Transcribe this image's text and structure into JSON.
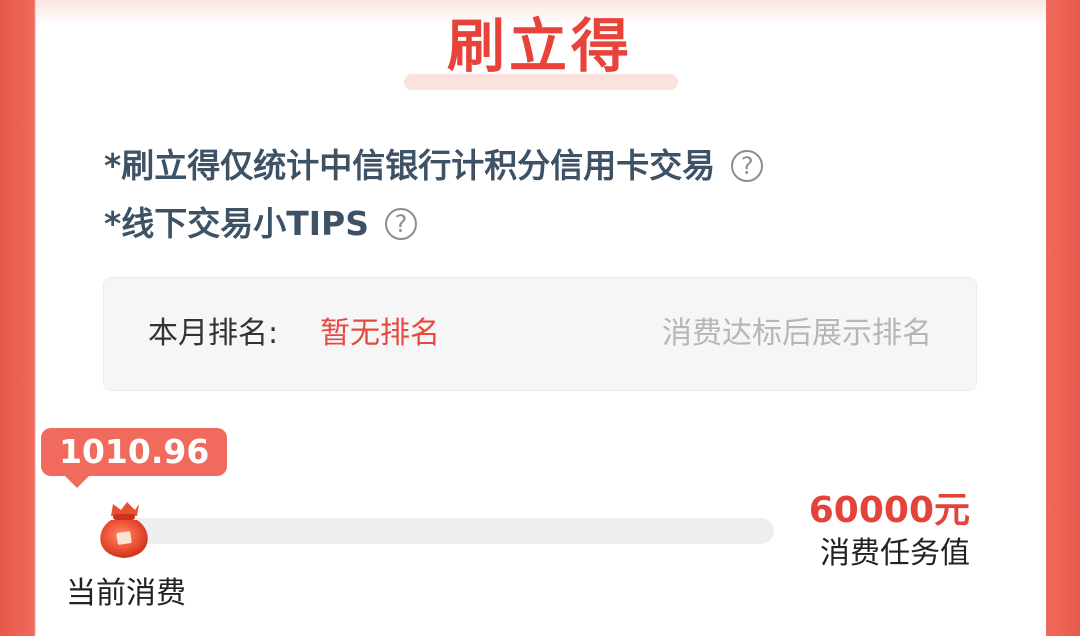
{
  "header": {
    "title": "刷立得"
  },
  "tips": [
    {
      "text": "*刷立得仅统计中信银行计积分信用卡交易",
      "icon": "question-circle-icon"
    },
    {
      "text": "*线下交易小TIPS",
      "icon": "question-circle-icon"
    }
  ],
  "ranking": {
    "label": "本月排名:",
    "value": "暂无排名",
    "hint": "消费达标后展示排名"
  },
  "progress": {
    "current_amount": "1010.96",
    "current_label": "当前消费",
    "target_amount": "60000元",
    "target_label": "消费任务值",
    "fraction": 0.0168
  },
  "colors": {
    "accent": "#e8433a",
    "badge": "#f06a5d",
    "tip_text": "#3e5266",
    "hint_text": "#b6b6b6"
  }
}
